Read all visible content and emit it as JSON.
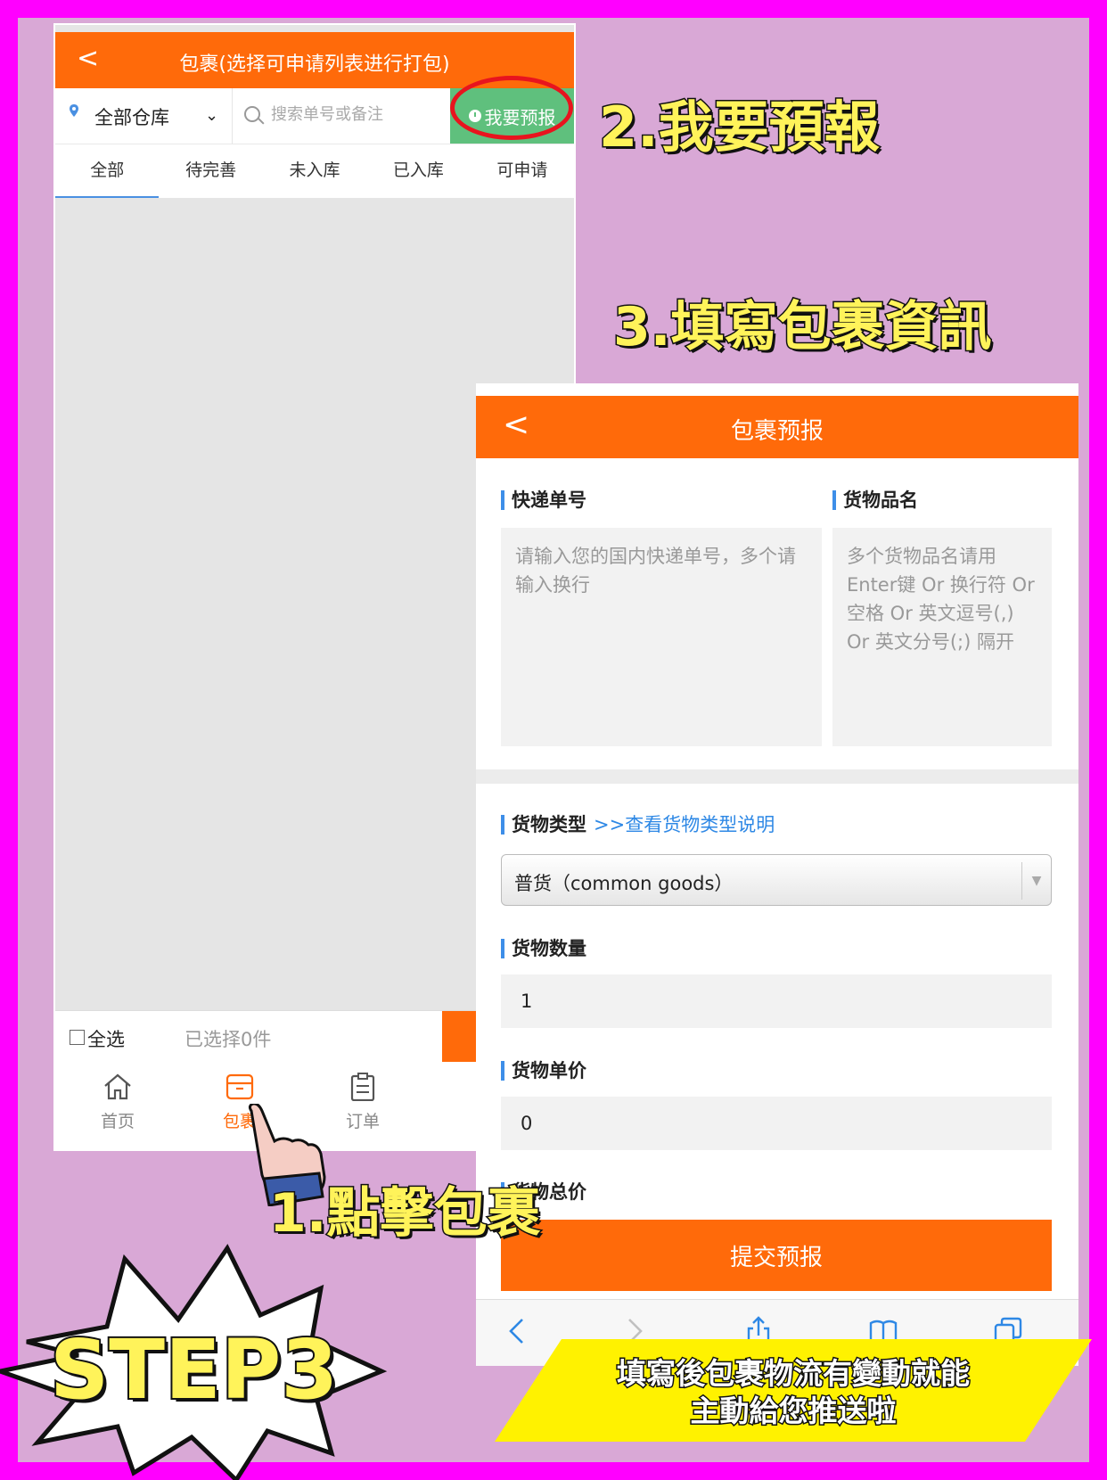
{
  "parcels_screen": {
    "back_glyph": "<",
    "title": "包裹(选择可申请列表进行打包)",
    "warehouse_filter": "全部仓库",
    "search_placeholder": "搜索单号或备注",
    "prereport_button": "我要预报",
    "tabs": [
      "全部",
      "待完善",
      "未入库",
      "已入库",
      "可申请"
    ],
    "active_tab": 0,
    "select_all_label": "全选",
    "selected_count_text": "已选择0件",
    "bottom_nav": [
      {
        "label": "首页",
        "icon": "home-icon"
      },
      {
        "label": "包裹",
        "icon": "package-icon",
        "active": true
      },
      {
        "label": "订单",
        "icon": "order-list-icon"
      }
    ]
  },
  "prereport_screen": {
    "back_glyph": "<",
    "title": "包裹预报",
    "tracking_label": "快递单号",
    "tracking_placeholder": "请输入您的国内快递单号，多个请输入换行",
    "goods_name_label": "货物品名",
    "goods_name_placeholder": "多个货物品名请用Enter键 Or 换行符 Or 空格 Or 英文逗号(,) Or 英文分号(;) 隔开",
    "goods_type_label": "货物类型",
    "goods_type_link": ">>查看货物类型说明",
    "goods_type_value": "普货（common goods）",
    "quantity_label": "货物数量",
    "quantity_value": "1",
    "unit_price_label": "货物单价",
    "unit_price_value": "0",
    "total_price_label": "货物总价",
    "submit_button": "提交预报",
    "browser_icons": [
      "back-icon",
      "forward-icon",
      "share-icon",
      "bookmarks-icon",
      "tabs-icon"
    ]
  },
  "annotations": {
    "step1": "1.點擊包裹",
    "step2": "2.我要預報",
    "step3": "3.填寫包裹資訊",
    "step_badge": "STEP3",
    "banner_line1": "填寫後包裹物流有變動就能",
    "banner_line2": "主動給您推送啦"
  },
  "colors": {
    "frame": "#ff00ff",
    "background": "#d9a8d6",
    "brand_orange": "#ff6a0a",
    "prereport_green": "#5fc07d",
    "highlight_red": "#e8141e",
    "annotation_yellow": "#fff35a",
    "link_blue": "#2e88e5"
  }
}
